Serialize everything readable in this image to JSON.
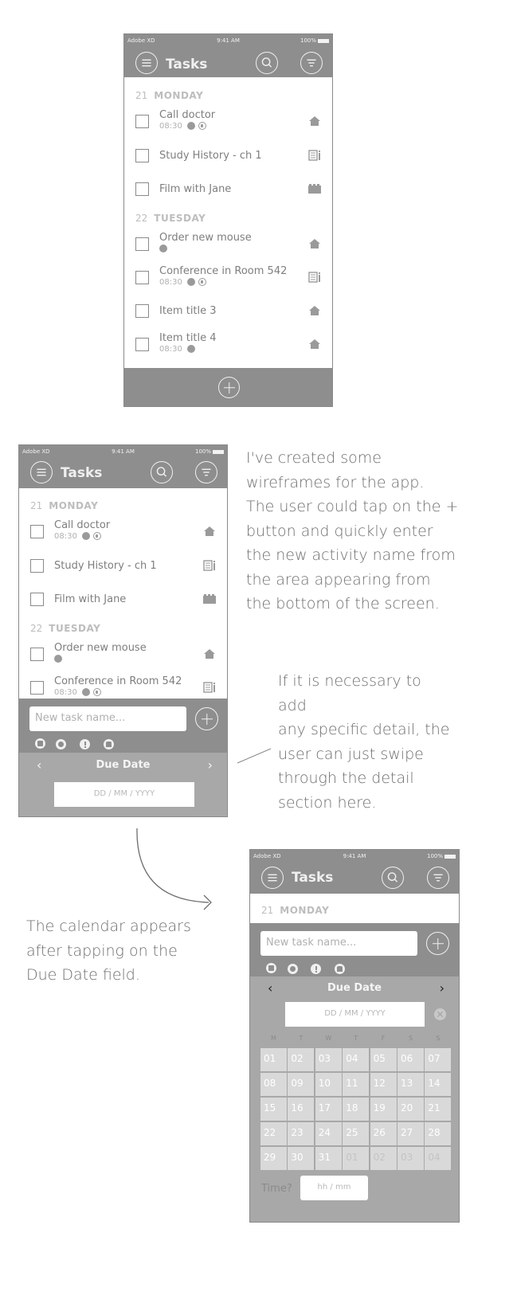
{
  "status_bar": {
    "carrier": "Adobe XD",
    "time": "9:41 AM",
    "battery": "100%"
  },
  "app": {
    "title": "Tasks"
  },
  "days": [
    {
      "number": "21",
      "name": "MONDAY"
    },
    {
      "number": "22",
      "name": "TUESDAY"
    }
  ],
  "tasks": [
    {
      "title": "Call doctor",
      "time": "08:30",
      "category": "home"
    },
    {
      "title": "Study History - ch 1",
      "category": "study"
    },
    {
      "title": "Film with Jane",
      "category": "film"
    },
    {
      "title": "Order new mouse",
      "category": "home"
    },
    {
      "title": "Conference in Room 542",
      "time": "08:30",
      "category": "study"
    },
    {
      "title": "Item title 3",
      "category": "home"
    },
    {
      "title": "Item title 4",
      "time": "08:30",
      "category": "home"
    }
  ],
  "quick_add": {
    "placeholder": "New task name...",
    "due_label": "Due Date",
    "date_placeholder": "DD / MM / YYYY",
    "time_label": "Time?",
    "time_placeholder": "hh / mm"
  },
  "calendar": {
    "weekdays": [
      "M",
      "T",
      "W",
      "T",
      "F",
      "S",
      "S"
    ],
    "days": [
      "01",
      "02",
      "03",
      "04",
      "05",
      "06",
      "07",
      "08",
      "09",
      "10",
      "11",
      "12",
      "13",
      "14",
      "15",
      "16",
      "17",
      "18",
      "19",
      "20",
      "21",
      "22",
      "23",
      "24",
      "25",
      "26",
      "27",
      "28",
      "29",
      "30",
      "31",
      "01",
      "02",
      "03",
      "04"
    ]
  },
  "notes": {
    "wireframes": [
      "I've created some",
      "wireframes for the app.",
      "The user could tap on the +",
      "button and quickly enter",
      "the new activity name from",
      "the area appearing from",
      "the bottom of the screen."
    ],
    "details": [
      "If it is necessary to",
      "add",
      "any specific detail, the",
      "user can just swipe",
      "through the detail",
      "section here."
    ],
    "calendar": [
      "The calendar appears",
      "after tapping on the",
      "Due Date field."
    ]
  },
  "colors": {
    "header": "#8e8e8e",
    "panel": "#a8a8a8",
    "cell": "#d9d9d9",
    "text": "#7e7e7e"
  }
}
